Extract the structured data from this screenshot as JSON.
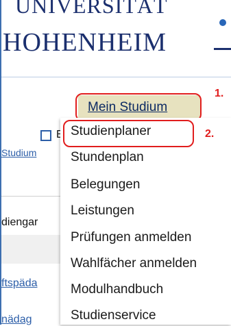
{
  "logo": {
    "line1": "UNIVERSITÄT",
    "line2": "HOHENHEIM"
  },
  "menu": {
    "main_label": "Mein Studium"
  },
  "background": {
    "checkbox_label": "E",
    "studium_text": "Studium",
    "studiengang_text": "diengar",
    "link_text": "ftspäda",
    "bottom_text": "nädag"
  },
  "dropdown": {
    "items": [
      "Studienplaner",
      "Stundenplan",
      "Belegungen",
      "Leistungen",
      "Prüfungen anmelden",
      "Wahlfächer anmelden",
      "Modulhandbuch",
      "Studienservice"
    ]
  },
  "annotations": {
    "step1": "1.",
    "step2": "2."
  },
  "colors": {
    "menu_button_bg": "#e7e2bf",
    "callout_red": "#e11d1d",
    "logo_blue": "#1b2f6e"
  }
}
